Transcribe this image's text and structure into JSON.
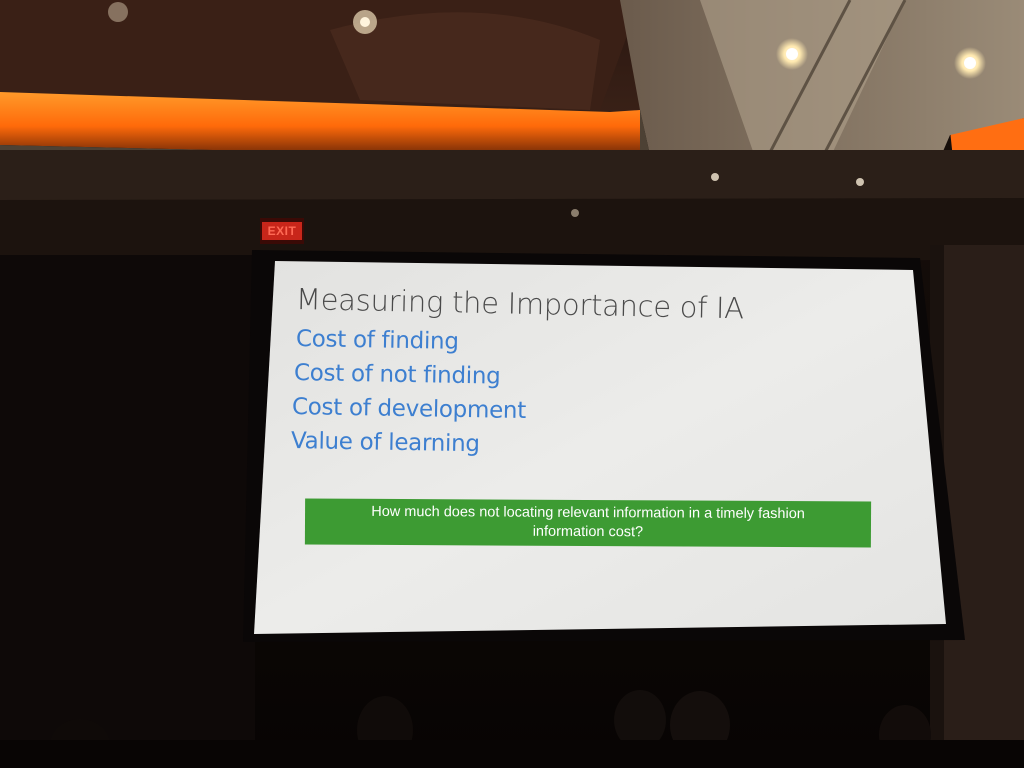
{
  "photo": {
    "exit_sign": "EXIT"
  },
  "slide": {
    "title": "Measuring the Importance of IA",
    "bullets": [
      "Cost of finding",
      "Cost of not finding",
      "Cost of development",
      "Value of learning"
    ],
    "callout": "How much does not locating relevant information in a timely fashion information cost?"
  },
  "colors": {
    "title_text": "#4a4a4a",
    "bullet_text": "#3d7fd0",
    "callout_background": "#3d9b33",
    "callout_text": "#ffffff",
    "screen_background": "#e9e9e7",
    "ceiling_glow": "#ff7a10",
    "exit_sign": "#ff3b2a"
  }
}
